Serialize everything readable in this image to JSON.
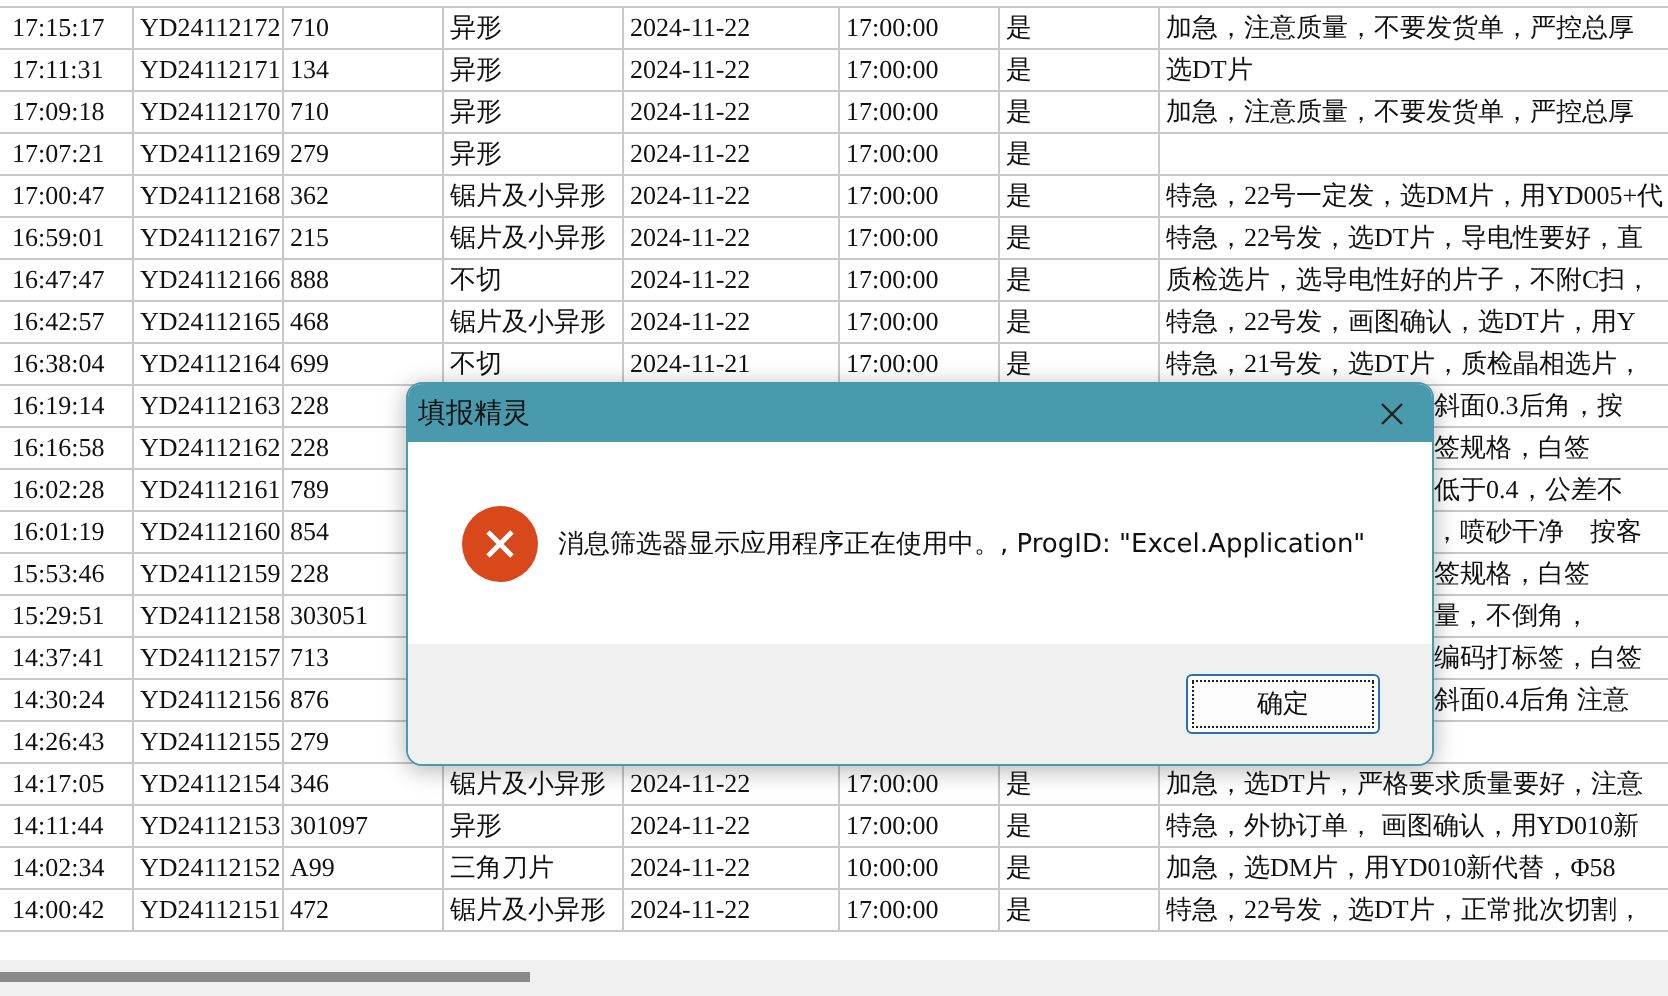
{
  "table": {
    "rows": [
      {
        "time": "17:15:17",
        "order": "YD24112172",
        "qty": "710",
        "type": "异形",
        "date": "2024-11-22",
        "due": "17:00:00",
        "flag": "是",
        "remark": "加急，注意质量，不要发货单，严控总厚"
      },
      {
        "time": "17:11:31",
        "order": "YD24112171",
        "qty": "134",
        "type": "异形",
        "date": "2024-11-22",
        "due": "17:00:00",
        "flag": "是",
        "remark": "选DT片"
      },
      {
        "time": "17:09:18",
        "order": "YD24112170",
        "qty": "710",
        "type": "异形",
        "date": "2024-11-22",
        "due": "17:00:00",
        "flag": "是",
        "remark": "加急，注意质量，不要发货单，严控总厚"
      },
      {
        "time": "17:07:21",
        "order": "YD24112169",
        "qty": "279",
        "type": "异形",
        "date": "2024-11-22",
        "due": "17:00:00",
        "flag": "是"
      },
      {
        "time": "17:00:47",
        "order": "YD24112168",
        "qty": "362",
        "type": "锯片及小异形",
        "date": "2024-11-22",
        "due": "17:00:00",
        "flag": "是",
        "remark": "特急，22号一定发，选DM片，用YD005+代"
      },
      {
        "time": "16:59:01",
        "order": "YD24112167",
        "qty": "215",
        "type": "锯片及小异形",
        "date": "2024-11-22",
        "due": "17:00:00",
        "flag": "是",
        "remark": "特急，22号发，选DT片，导电性要好，直"
      },
      {
        "time": "16:47:47",
        "order": "YD24112166",
        "qty": "888",
        "type": "不切",
        "date": "2024-11-22",
        "due": "17:00:00",
        "flag": "是",
        "remark": "质检选片，选导电性好的片子，不附C扫，"
      },
      {
        "time": "16:42:57",
        "order": "YD24112165",
        "qty": "468",
        "type": "锯片及小异形",
        "date": "2024-11-22",
        "due": "17:00:00",
        "flag": "是",
        "remark": "特急，22号发，画图确认，选DT片，用Y"
      },
      {
        "time": "16:38:04",
        "order": "YD24112164",
        "qty": "699",
        "type": "不切",
        "date": "2024-11-21",
        "due": "17:00:00",
        "flag": "是",
        "remark": "特急，21号发，选DT片，质检晶相选片，"
      },
      {
        "time": "16:19:14",
        "order": "YD24112163",
        "qty": "228",
        "remark_tail": "斜面0.3后角，按"
      },
      {
        "time": "16:16:58",
        "order": "YD24112162",
        "qty": "228",
        "remark_tail": "签规格，白签"
      },
      {
        "time": "16:02:28",
        "order": "YD24112161",
        "qty": "789",
        "remark_tail": "低于0.4，公差不"
      },
      {
        "time": "16:01:19",
        "order": "YD24112160",
        "qty": "854",
        "remark_tail": "，喷砂干净　按客"
      },
      {
        "time": "15:53:46",
        "order": "YD24112159",
        "qty": "228",
        "remark_tail": "签规格，白签"
      },
      {
        "time": "15:29:51",
        "order": "YD24112158",
        "qty": "303051",
        "remark_tail": "量，不倒角，"
      },
      {
        "time": "14:37:41",
        "order": "YD24112157",
        "qty": "713",
        "remark_tail": "编码打标签，白签"
      },
      {
        "time": "14:30:24",
        "order": "YD24112156",
        "qty": "876",
        "remark_tail": "斜面0.4后角 注意"
      },
      {
        "time": "14:26:43",
        "order": "YD24112155",
        "qty": "279"
      },
      {
        "time": "14:17:05",
        "order": "YD24112154",
        "qty": "346",
        "type": "锯片及小异形",
        "date": "2024-11-22",
        "due": "17:00:00",
        "flag": "是",
        "remark": "加急，选DT片，严格要求质量要好，注意"
      },
      {
        "time": "14:11:44",
        "order": "YD24112153",
        "qty": "301097",
        "type": "异形",
        "date": "2024-11-22",
        "due": "17:00:00",
        "flag": "是",
        "remark": "特急，外协订单， 画图确认，用YD010新"
      },
      {
        "time": "14:02:34",
        "order": "YD24112152",
        "qty": "A99",
        "type": "三角刀片",
        "date": "2024-11-22",
        "due": "10:00:00",
        "flag": "是",
        "remark": "加急，选DM片，用YD010新代替，Φ58"
      },
      {
        "time": "14:00:42",
        "order": "YD24112151",
        "qty": "472",
        "type": "锯片及小异形",
        "date": "2024-11-22",
        "due": "17:00:00",
        "flag": "是",
        "remark": "特急，22号发，选DT片，正常批次切割，"
      }
    ]
  },
  "dialog": {
    "title": "填报精灵",
    "kind": "error",
    "message": "消息筛选器显示应用程序正在使用中。, ProgID: \"Excel.Application\"",
    "buttons": [
      {
        "label": "确定",
        "selected": true
      }
    ]
  }
}
